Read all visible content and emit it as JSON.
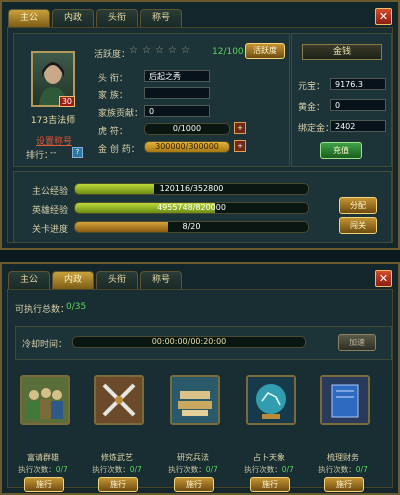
{
  "tabs": [
    "主公",
    "内政",
    "头衔",
    "称号"
  ],
  "close_icon": "close-icon",
  "lord": {
    "level": "30",
    "name": "173吉法师",
    "set_title": "设置称号",
    "rank_label": "排行：",
    "rank_value": "--",
    "vigor_label": "活跃度：",
    "vigor_count": "12/100",
    "vigor_button": "活跃度",
    "title_label": "头    衔：",
    "title_value": "后起之秀",
    "family_label": "家    族：",
    "family_value": "",
    "contrib_label": "家族贡献：",
    "contrib_value": "0",
    "tiger_label": "虎    符：",
    "tiger_value": "0/1000",
    "tiger_fraction": 0,
    "potion_label": "金 创 药：",
    "potion_value": "300000/300000",
    "potion_fraction": 1.0
  },
  "money": {
    "title": "金钱",
    "yuanbao_label": "元宝：",
    "yuanbao": "9176.3",
    "gold_label": "黄金：",
    "gold": "0",
    "bound_label": "绑定金：",
    "bound": "2402",
    "recharge": "充值"
  },
  "exp": {
    "lord_label": "主公经验",
    "lord_value": "120116/352800",
    "lord_fraction": 0.34,
    "hero_label": "英雄经验",
    "hero_value": "4955748/820000",
    "hero_fraction": 0.6,
    "stage_label": "关卡进度",
    "stage_value": "8/20",
    "stage_fraction": 0.4,
    "assign": "分配",
    "stage_btn": "闯关"
  },
  "affairs": {
    "total_label": "可执行总数：",
    "total": "0/35",
    "cooldown_label": "冷却时间：",
    "cooldown": "00:00:00/00:20:00",
    "speed": "加速",
    "count_prefix": "执行次数：",
    "exec": "施行",
    "tasks": [
      {
        "name": "富请群雄",
        "count": "0/7",
        "icon": "soldiers-icon"
      },
      {
        "name": "修炼武艺",
        "count": "0/7",
        "icon": "crossed-swords-icon"
      },
      {
        "name": "研究兵法",
        "count": "0/7",
        "icon": "scrolls-icon"
      },
      {
        "name": "占卜天象",
        "count": "0/7",
        "icon": "crystal-ball-icon"
      },
      {
        "name": "梳理财务",
        "count": "0/7",
        "icon": "book-icon"
      }
    ]
  }
}
